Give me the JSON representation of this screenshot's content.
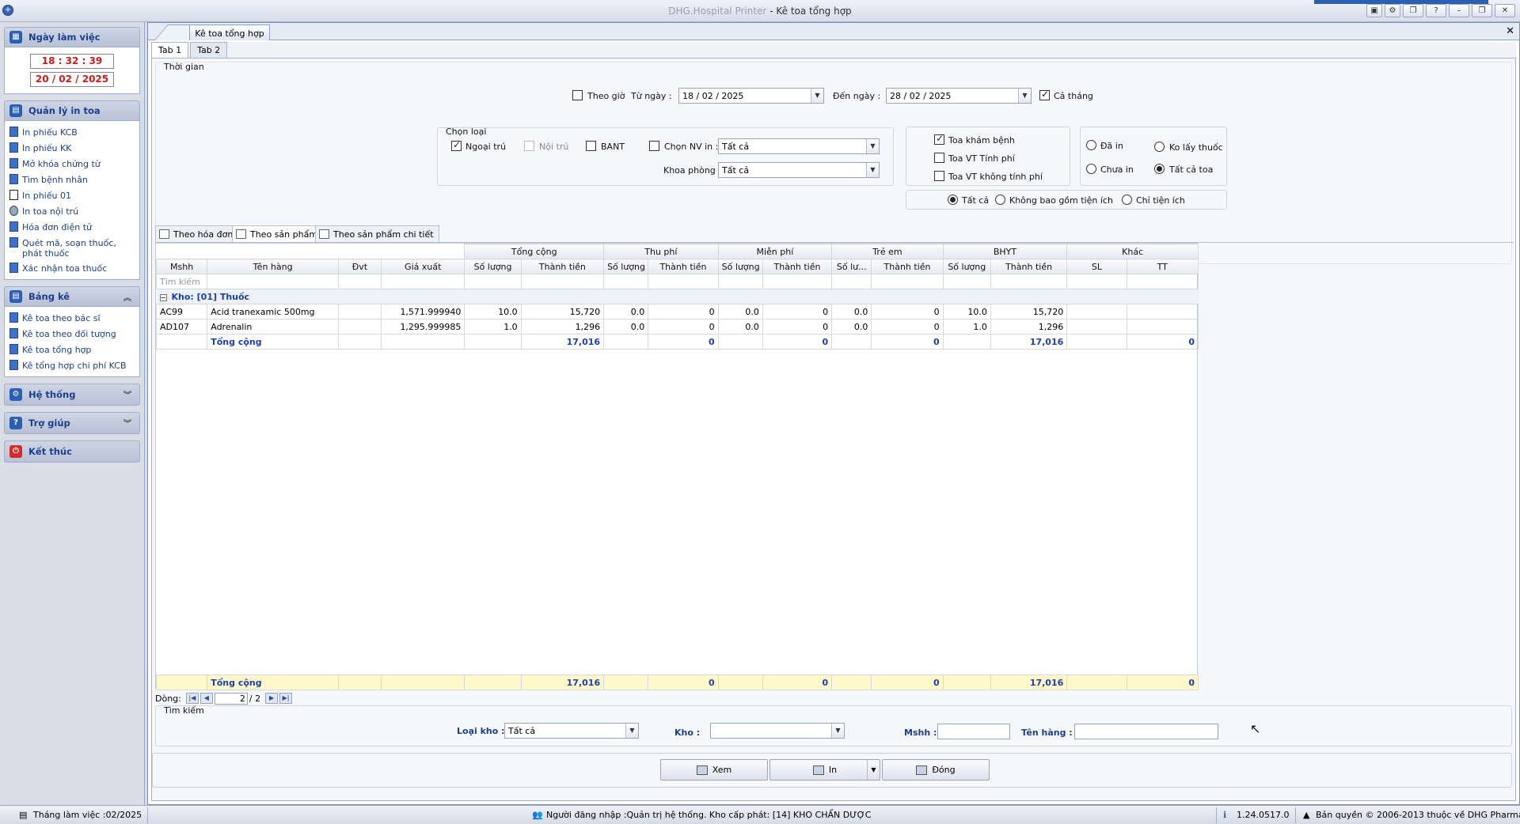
{
  "window": {
    "app_name": "DHG.Hospital Printer",
    "separator": " - ",
    "doc_name": "Kê toa tổng hợp"
  },
  "sidebar": {
    "workday": {
      "title": "Ngày làm việc",
      "time": "18 : 32 : 39",
      "date": "20 / 02 / 2025"
    },
    "print_mgmt": {
      "title": "Quản lý in toa",
      "items": [
        "In phiếu KCB",
        "In phiếu KK",
        "Mở khóa chứng từ",
        "Tìm bệnh nhân",
        "In phiếu 01",
        "In toa nội trú",
        "Hóa đơn điện tử",
        "Quét mã, soạn thuốc, phát thuốc",
        "Xác nhận toa thuốc"
      ]
    },
    "reports": {
      "title": "Bảng kê",
      "items": [
        "Kê toa theo bác sĩ",
        "Kê toa theo đối tượng",
        "Kê toa tổng hợp",
        "Kê tổng hợp chi phí KCB"
      ]
    },
    "system": "Hệ thống",
    "help": "Trợ giúp",
    "exit": "Kết thúc"
  },
  "doc_tab": "Kê toa tổng hợp",
  "sub_tabs": [
    "Tab 1",
    "Tab 2"
  ],
  "filters": {
    "time_group": "Thời gian",
    "by_hour": "Theo giờ",
    "from_label": "Từ ngày :",
    "from_value": "18 / 02 / 2025",
    "to_label": "Đến ngày :",
    "to_value": "28 / 02 / 2025",
    "whole_month": "Cả tháng",
    "type_group": "Chọn loại",
    "outpatient": "Ngoại trú",
    "inpatient": "Nội trú",
    "bant": "BANT",
    "choose_staff": "Chọn NV in :",
    "staff_value": "Tất cả",
    "department_label": "Khoa phòng :",
    "department_value": "Tất cả",
    "exam_rx": "Toa khám bệnh",
    "vt_charged": "Toa VT Tính phí",
    "vt_free": "Toa VT không tính phí",
    "printed": "Đã in",
    "not_printed": "Chưa in",
    "no_drug": "Ko lấy thuốc",
    "all_rx": "Tất cả toa",
    "util_all": "Tất cả",
    "util_excl": "Không bao gồm tiện ích",
    "util_only": "Chỉ tiện ích"
  },
  "view_tabs": [
    "Theo hóa đơn",
    "Theo sản phẩm",
    "Theo sản phẩm chi tiết"
  ],
  "grid": {
    "band_headers": [
      "Tổng cộng",
      "Thu phí",
      "Miễn phí",
      "Trẻ em",
      "BHYT",
      "Khác"
    ],
    "columns": [
      "Mshh",
      "Tên hàng",
      "Đvt",
      "Giá xuất",
      "Số lượng",
      "Thành tiền",
      "Số lượng",
      "Thành tiền",
      "Số lượng",
      "Thành tiền",
      "Số lư...",
      "Thành tiền",
      "Số lượng",
      "Thành tiền",
      "SL",
      "TT"
    ],
    "search_placeholder": "Tìm kiếm",
    "group_label": "Kho: [01] Thuốc",
    "rows": [
      [
        "AC99",
        "Acid tranexamic 500mg",
        "",
        "1,571.999940",
        "10.0",
        "15,720",
        "0.0",
        "0",
        "0.0",
        "0",
        "0.0",
        "0",
        "10.0",
        "15,720",
        "",
        ""
      ],
      [
        "AD107",
        "Adrenalin",
        "",
        "1,295.999985",
        "1.0",
        "1,296",
        "0.0",
        "0",
        "0.0",
        "0",
        "0.0",
        "0",
        "1.0",
        "1,296",
        "",
        ""
      ]
    ],
    "group_total": [
      "",
      "Tổng cộng",
      "",
      "",
      "",
      "17,016",
      "",
      "0",
      "",
      "0",
      "",
      "0",
      "",
      "17,016",
      "",
      "0"
    ],
    "footer_total": [
      "",
      "Tổng cộng",
      "",
      "",
      "",
      "17,016",
      "",
      "0",
      "",
      "0",
      "",
      "0",
      "",
      "17,016",
      "",
      "0"
    ]
  },
  "pager": {
    "label": "Dòng:",
    "current": "2",
    "of": "/  2"
  },
  "search": {
    "title": "Tìm kiếm",
    "warehouse_type_label": "Loại kho :",
    "warehouse_type_value": "Tất cả",
    "warehouse_label": "Kho :",
    "warehouse_value": "",
    "mshh_label": "Mshh :",
    "name_label": "Tên hàng :"
  },
  "actions": {
    "view": "Xem",
    "print": "In",
    "close": "Đóng"
  },
  "status": {
    "month": "Tháng làm việc :02/2025",
    "user": "Người đăng nhập :Quản trị hệ thống. Kho cấp phát: [14] KHO CHẨN DƯỢC",
    "version": "1.24.0517.0",
    "copyright": "Bản quyền © 2006-2013 thuộc về DHG Pharma"
  }
}
